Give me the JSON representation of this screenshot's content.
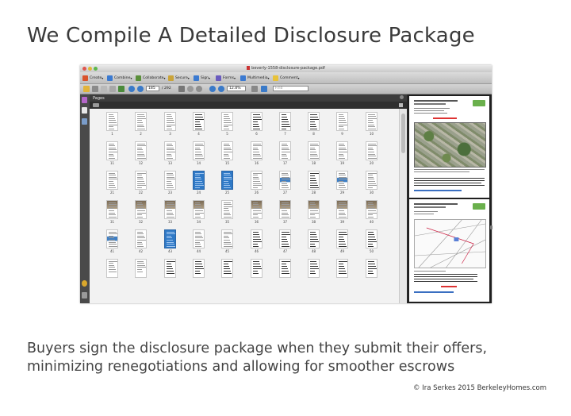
{
  "slide": {
    "title": "We Compile A Detailed Disclosure Package",
    "caption_line1": "Buyers sign the disclosure package when they submit their offers,",
    "caption_line2": "minimizing renegotiations and allowing for smoother escrows",
    "credit": "© Ira Serkes 2015 BerkeleyHomes.com"
  },
  "window": {
    "title": "beverly-1558-disclosure-package.pdf"
  },
  "toolbar": {
    "items": [
      {
        "label": "Create",
        "icon": "create-icon",
        "color": "#d9532c"
      },
      {
        "label": "Combine",
        "icon": "combine-icon",
        "color": "#3b7ad1"
      },
      {
        "label": "Collaborate",
        "icon": "collaborate-icon",
        "color": "#5a8f3a"
      },
      {
        "label": "Secure",
        "icon": "lock-icon",
        "color": "#caa43a"
      },
      {
        "label": "Sign",
        "icon": "pen-icon",
        "color": "#3b7ad1"
      },
      {
        "label": "Forms",
        "icon": "forms-icon",
        "color": "#6a5bbf"
      },
      {
        "label": "Multimedia",
        "icon": "multimedia-icon",
        "color": "#3b7ad1"
      },
      {
        "label": "Comment",
        "icon": "comment-icon",
        "color": "#e8c23a"
      }
    ]
  },
  "nav": {
    "page_current": "185",
    "page_total": "/ 292",
    "zoom": "12.8%",
    "find_placeholder": "Find"
  },
  "pages_panel": {
    "title": "Pages",
    "row_labels": [
      [
        "1",
        "2",
        "3",
        "4",
        "5",
        "6",
        "7",
        "8",
        "9",
        "10"
      ],
      [
        "11",
        "12",
        "13",
        "14",
        "15",
        "16",
        "17",
        "18",
        "19",
        "20"
      ],
      [
        "21",
        "22",
        "23",
        "24",
        "25",
        "26",
        "27",
        "28",
        "29",
        "30"
      ],
      [
        "31",
        "32",
        "33",
        "34",
        "35",
        "36",
        "37",
        "38",
        "39",
        "40"
      ],
      [
        "41",
        "42",
        "43",
        "44",
        "45",
        "46",
        "47",
        "48",
        "49",
        "50"
      ],
      [
        "51",
        "52",
        "53",
        "54",
        "55",
        "56",
        "57",
        "58",
        "59",
        "60"
      ]
    ]
  },
  "colors": {
    "accent_blue": "#2f79c6",
    "logo_green": "#6ab04c",
    "window_dark": "#2b2b2b"
  }
}
